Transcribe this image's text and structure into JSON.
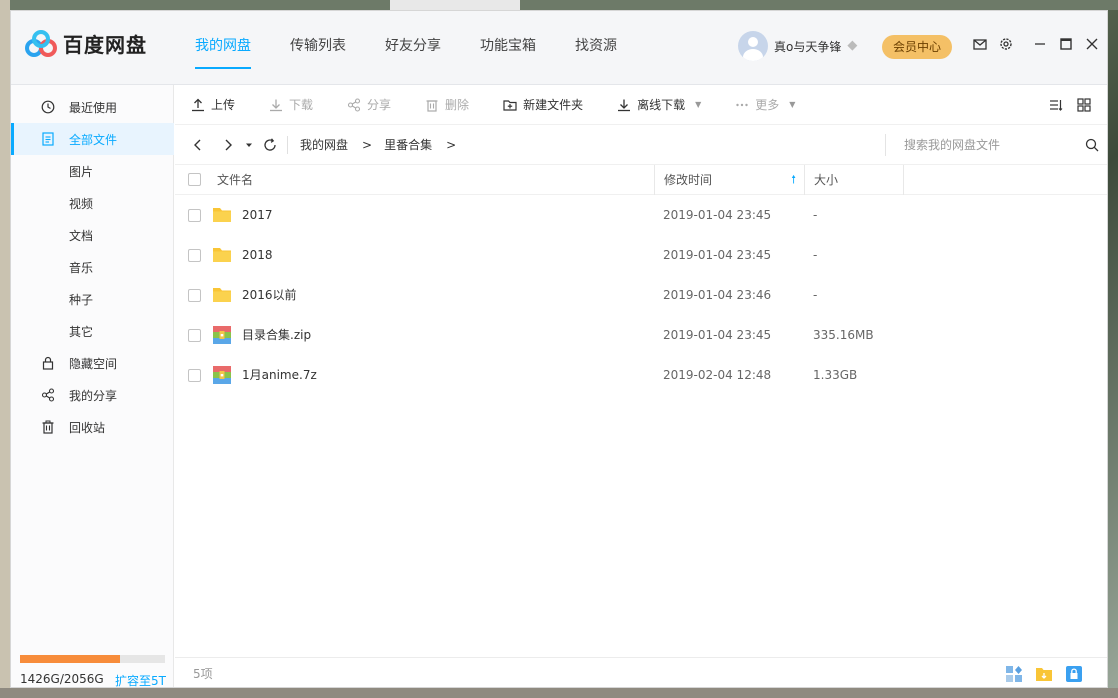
{
  "app": {
    "name": "百度网盘"
  },
  "nav": [
    {
      "label": "我的网盘",
      "active": true
    },
    {
      "label": "传输列表"
    },
    {
      "label": "好友分享"
    },
    {
      "label": "功能宝箱"
    },
    {
      "label": "找资源"
    }
  ],
  "user": {
    "name": "真o与天争锋",
    "vip_label": "会员中心"
  },
  "window_icons": [
    "mail-icon",
    "settings-icon",
    "minimize-icon",
    "maximize-icon",
    "close-icon"
  ],
  "sidebar": {
    "items": [
      {
        "label": "最近使用",
        "icon": "clock-icon"
      },
      {
        "label": "全部文件",
        "icon": "file-icon",
        "active": true
      },
      {
        "label": "图片"
      },
      {
        "label": "视频"
      },
      {
        "label": "文档"
      },
      {
        "label": "音乐"
      },
      {
        "label": "种子"
      },
      {
        "label": "其它"
      },
      {
        "label": "隐藏空间",
        "icon": "lock-icon"
      },
      {
        "label": "我的分享",
        "icon": "share-icon"
      },
      {
        "label": "回收站",
        "icon": "trash-icon"
      }
    ],
    "quota": {
      "text": "1426G/2056G",
      "used_fraction": 0.69,
      "expand_label": "扩容至5T"
    }
  },
  "toolbar": {
    "upload": "上传",
    "download": "下载",
    "share": "分享",
    "delete": "删除",
    "new_folder": "新建文件夹",
    "offline_download": "离线下载",
    "more": "更多"
  },
  "path": {
    "crumbs": [
      "我的网盘",
      "里番合集"
    ],
    "separator": ">",
    "search_placeholder": "搜索我的网盘文件"
  },
  "table": {
    "headers": {
      "name": "文件名",
      "time": "修改时间",
      "size": "大小"
    },
    "rows": [
      {
        "name": "2017",
        "time": "2019-01-04 23:45",
        "size": "-",
        "type": "folder"
      },
      {
        "name": "2018",
        "time": "2019-01-04 23:45",
        "size": "-",
        "type": "folder"
      },
      {
        "name": "2016以前",
        "time": "2019-01-04 23:46",
        "size": "-",
        "type": "folder"
      },
      {
        "name": "目录合集.zip",
        "time": "2019-01-04 23:45",
        "size": "335.16MB",
        "type": "archive"
      },
      {
        "name": "1月anime.7z",
        "time": "2019-02-04 12:48",
        "size": "1.33GB",
        "type": "archive"
      }
    ]
  },
  "status": {
    "count": "5项"
  },
  "colors": {
    "accent": "#09aaff",
    "folder": "#f9c536",
    "quota": "#f78c3b",
    "vip": "#f4c066"
  }
}
